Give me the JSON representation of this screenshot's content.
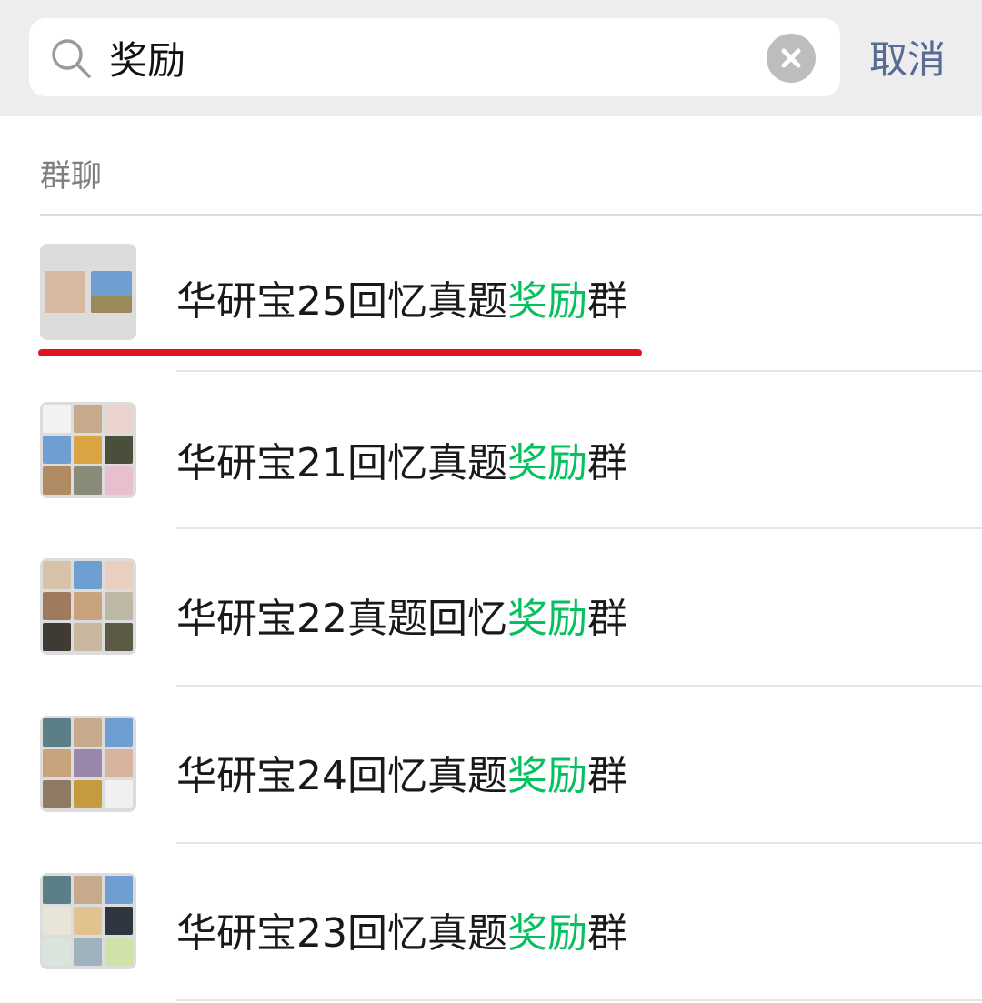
{
  "search": {
    "query": "奖励",
    "cancel_label": "取消"
  },
  "section": {
    "title": "群聊"
  },
  "results": [
    {
      "prefix": "华研宝25回忆真题",
      "highlight": "奖励",
      "suffix": "群"
    },
    {
      "prefix": "华研宝21回忆真题",
      "highlight": "奖励",
      "suffix": "群"
    },
    {
      "prefix": "华研宝22真题回忆",
      "highlight": "奖励",
      "suffix": "群"
    },
    {
      "prefix": "华研宝24回忆真题",
      "highlight": "奖励",
      "suffix": "群"
    },
    {
      "prefix": "华研宝23回忆真题",
      "highlight": "奖励",
      "suffix": "群"
    }
  ],
  "colors": {
    "highlight": "#07c160",
    "cancel": "#576b95",
    "annotation": "#e0141e"
  },
  "icons": {
    "search": "search-icon",
    "clear": "close-circle-icon"
  }
}
